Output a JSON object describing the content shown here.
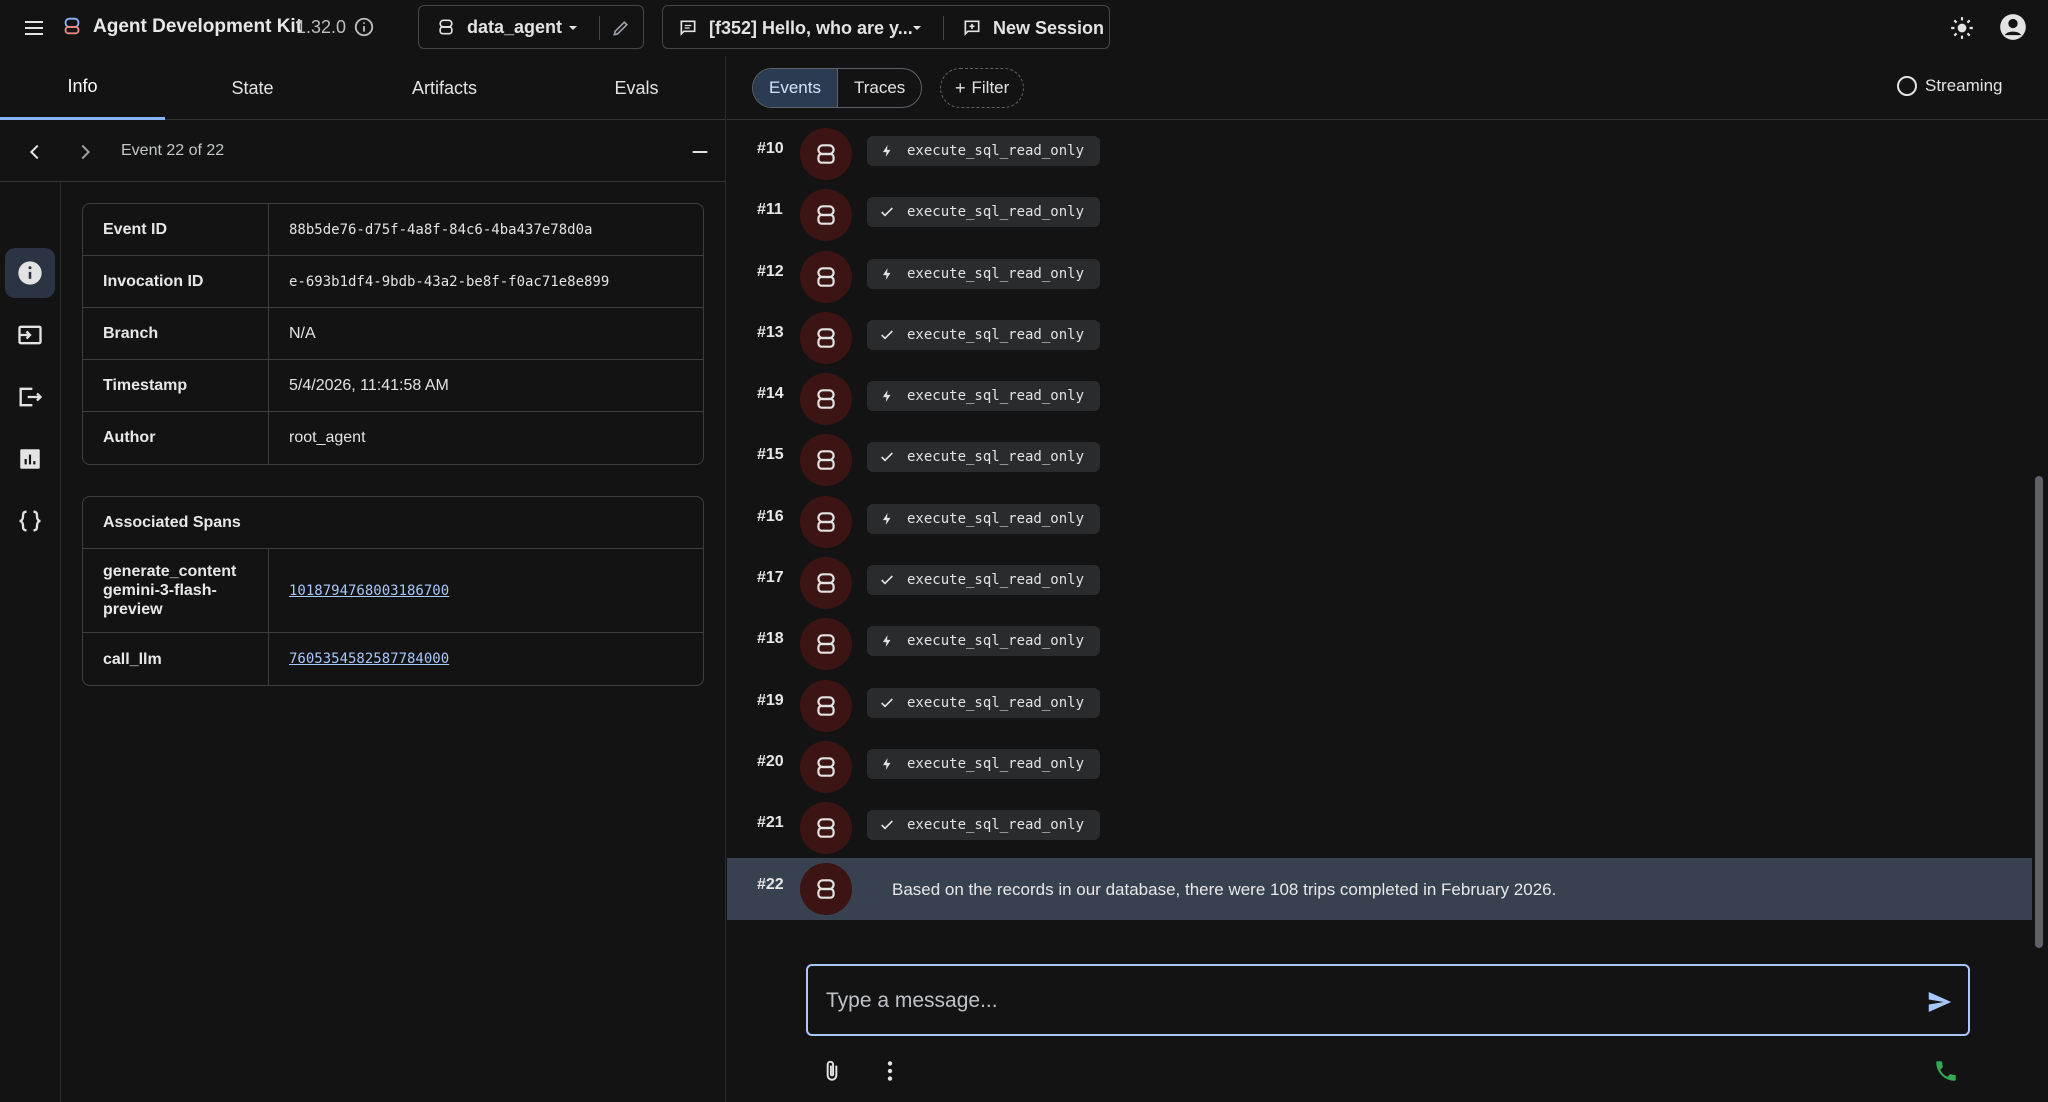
{
  "header": {
    "app_title": "Agent Development Kit",
    "version": "1.32.0",
    "agent_name": "data_agent",
    "session_label": "[f352] Hello, who are y...",
    "new_session_label": "New Session"
  },
  "left": {
    "tabs": [
      {
        "label": "Info",
        "active": true
      },
      {
        "label": "State",
        "active": false
      },
      {
        "label": "Artifacts",
        "active": false
      },
      {
        "label": "Evals",
        "active": false
      }
    ],
    "event_counter": "Event 22 of 22",
    "info_rows": [
      {
        "key": "Event ID",
        "value": "88b5de76-d75f-4a8f-84c6-4ba437e78d0a"
      },
      {
        "key": "Invocation ID",
        "value": "e-693b1df4-9bdb-43a2-be8f-f0ac71e8e899"
      },
      {
        "key": "Branch",
        "value": "N/A"
      },
      {
        "key": "Timestamp",
        "value": "5/4/2026, 11:41:58 AM"
      },
      {
        "key": "Author",
        "value": "root_agent"
      }
    ],
    "spans_title": "Associated Spans",
    "spans": [
      {
        "key": "generate_content gemini-3-flash-preview",
        "value": "1018794768003186700"
      },
      {
        "key": "call_llm",
        "value": "7605354582587784000"
      }
    ]
  },
  "right": {
    "seg_events": "Events",
    "seg_traces": "Traces",
    "filter_label": "Filter",
    "streaming_label": "Streaming",
    "events": [
      {
        "num": "#10",
        "kind": "call",
        "text": "execute_sql_read_only"
      },
      {
        "num": "#11",
        "kind": "response",
        "text": "execute_sql_read_only"
      },
      {
        "num": "#12",
        "kind": "call",
        "text": "execute_sql_read_only"
      },
      {
        "num": "#13",
        "kind": "response",
        "text": "execute_sql_read_only"
      },
      {
        "num": "#14",
        "kind": "call",
        "text": "execute_sql_read_only"
      },
      {
        "num": "#15",
        "kind": "response",
        "text": "execute_sql_read_only"
      },
      {
        "num": "#16",
        "kind": "call",
        "text": "execute_sql_read_only"
      },
      {
        "num": "#17",
        "kind": "response",
        "text": "execute_sql_read_only"
      },
      {
        "num": "#18",
        "kind": "call",
        "text": "execute_sql_read_only"
      },
      {
        "num": "#19",
        "kind": "response",
        "text": "execute_sql_read_only"
      },
      {
        "num": "#20",
        "kind": "call",
        "text": "execute_sql_read_only"
      },
      {
        "num": "#21",
        "kind": "response",
        "text": "execute_sql_read_only"
      }
    ],
    "selected_event": {
      "num": "#22",
      "text": "Based on the records in our database, there were 108 trips completed in February 2026."
    },
    "composer_placeholder": "Type a message..."
  },
  "colors": {
    "accent": "#8ab4f8",
    "avatar_bg": "#3c1414",
    "call_green": "#34a853",
    "link": "#a8c7fa"
  },
  "icons": [
    "menu-icon",
    "robot-icon",
    "info-icon",
    "chevron-down-icon",
    "edit-icon",
    "chat-icon",
    "new-session-icon",
    "sun-icon",
    "account-icon",
    "chevron-left-icon",
    "chevron-right-icon",
    "minimize-icon",
    "bolt-icon",
    "check-icon",
    "send-icon",
    "attach-icon",
    "more-vert-icon",
    "phone-icon"
  ]
}
